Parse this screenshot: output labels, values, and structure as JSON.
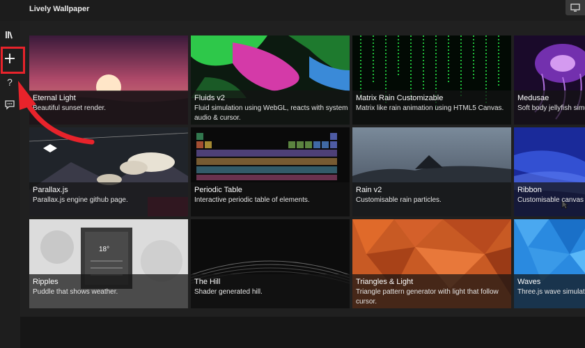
{
  "app": {
    "title": "Lively Wallpaper"
  },
  "sidebar": {
    "items": [
      {
        "name": "library",
        "icon": "library-icon"
      },
      {
        "name": "add-wallpaper",
        "icon": "plus-icon"
      },
      {
        "name": "help",
        "icon": "help-icon"
      },
      {
        "name": "feedback",
        "icon": "chat-icon"
      }
    ]
  },
  "highlight_color": "#e8232b",
  "wallpapers": [
    {
      "name": "Eternal Light",
      "desc": "Beautiful sunset render."
    },
    {
      "name": "Fluids v2",
      "desc": "Fluid simulation using WebGL, reacts with system audio & cursor."
    },
    {
      "name": "Matrix Rain Customizable",
      "desc": "Matrix like rain animation using HTML5 Canvas."
    },
    {
      "name": "Medusae",
      "desc": "Soft body jellyfish simulation."
    },
    {
      "name": "Parallax.js",
      "desc": "Parallax.js engine github page."
    },
    {
      "name": "Periodic Table",
      "desc": "Interactive periodic table of elements."
    },
    {
      "name": "Rain v2",
      "desc": "Customisable rain particles."
    },
    {
      "name": "Ribbon",
      "desc": "Customisable canvas ribbon."
    },
    {
      "name": "Ripples",
      "desc": "Puddle that shows weather."
    },
    {
      "name": "The Hill",
      "desc": "Shader generated hill."
    },
    {
      "name": "Triangles & Light",
      "desc": "Triangle pattern generator with light that follow cursor."
    },
    {
      "name": "Waves",
      "desc": "Three.js wave simulation."
    }
  ],
  "ripples_weather": {
    "temp": "18°"
  }
}
